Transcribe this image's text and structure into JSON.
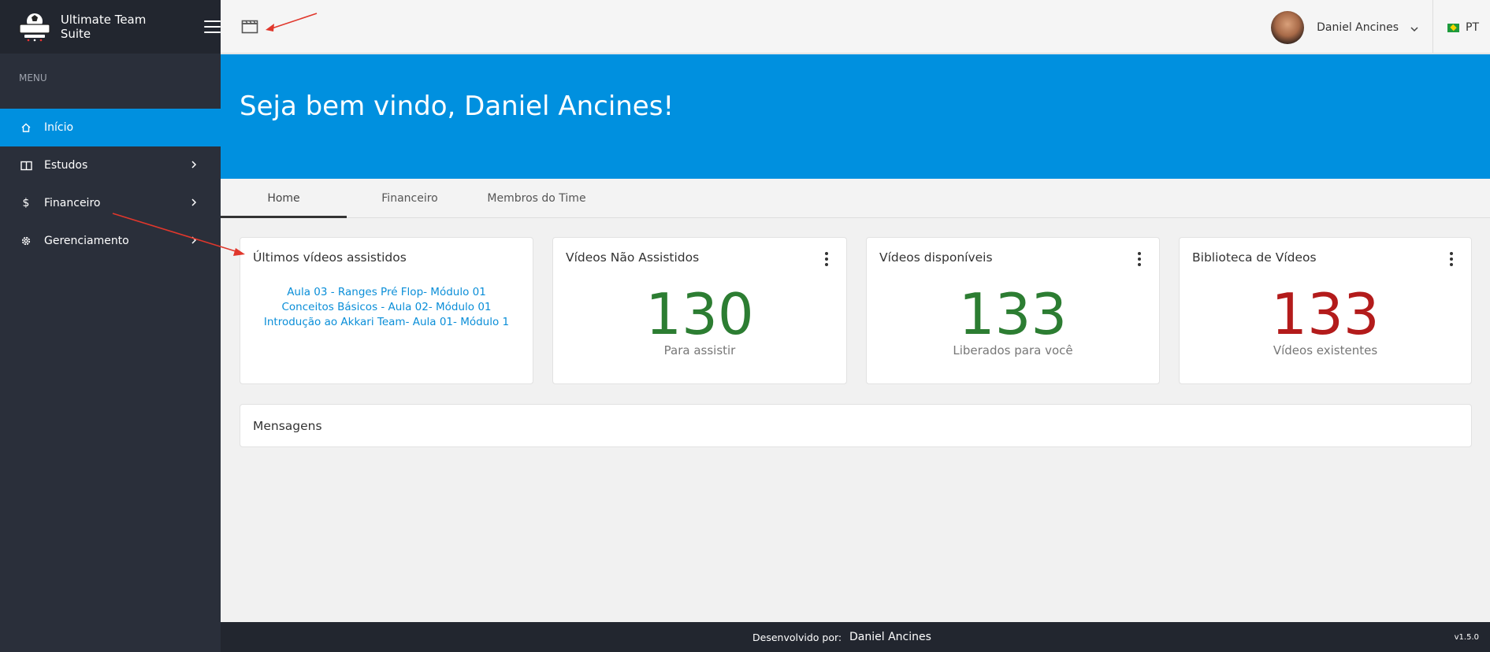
{
  "app": {
    "name": "Ultimate Team Suite"
  },
  "sidebar": {
    "menu_title": "MENU",
    "items": [
      {
        "label": "Início",
        "icon": "home-icon",
        "active": true
      },
      {
        "label": "Estudos",
        "icon": "book-icon",
        "active": false
      },
      {
        "label": "Financeiro",
        "icon": "dollar-icon",
        "active": false
      },
      {
        "label": "Gerenciamento",
        "icon": "gear-icon",
        "active": false
      }
    ]
  },
  "header": {
    "user_name": "Daniel Ancines",
    "language": "PT"
  },
  "banner": {
    "welcome": "Seja bem vindo, Daniel Ancines!"
  },
  "tabs": [
    {
      "label": "Home",
      "active": true
    },
    {
      "label": "Financeiro",
      "active": false
    },
    {
      "label": "Membros do Time",
      "active": false
    }
  ],
  "cards": {
    "recent": {
      "title": "Últimos vídeos assistidos",
      "links": [
        "Aula 03 - Ranges Pré Flop- Módulo 01",
        "Conceitos Básicos - Aula 02- Módulo 01",
        "Introdução ao Akkari Team- Aula 01- Módulo 1"
      ]
    },
    "unwatched": {
      "title": "Vídeos Não Assistidos",
      "value": "130",
      "label": "Para assistir"
    },
    "available": {
      "title": "Vídeos disponíveis",
      "value": "133",
      "label": "Liberados para você"
    },
    "library": {
      "title": "Biblioteca de Vídeos",
      "value": "133",
      "label": "Vídeos existentes"
    }
  },
  "messages": {
    "title": "Mensagens"
  },
  "footer": {
    "developed_by": "Desenvolvido por:",
    "developer": "Daniel Ancines",
    "version": "v1.5.0"
  },
  "colors": {
    "primary": "#0090df",
    "sidebar": "#2a2f3a",
    "green": "#2c7d32",
    "red": "#b31b1b",
    "annotation_arrow": "#e0372c"
  }
}
